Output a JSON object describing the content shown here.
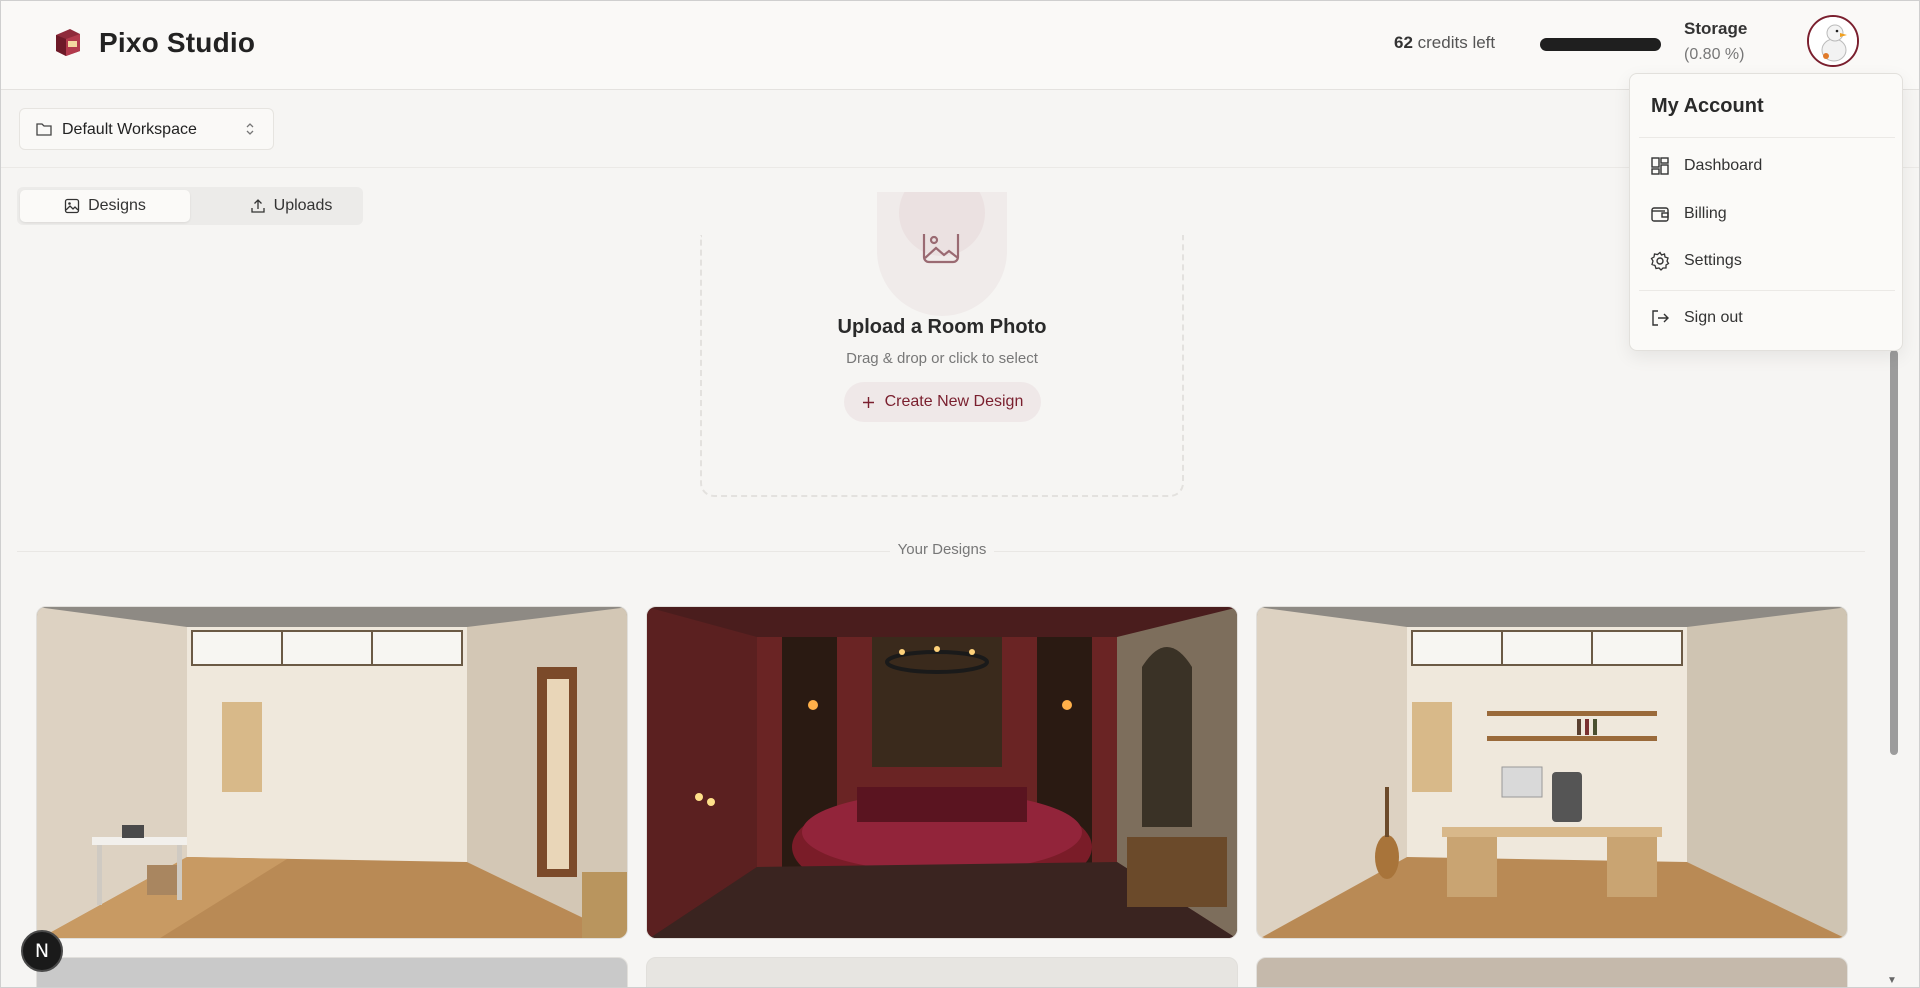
{
  "header": {
    "brand": "Pixo Studio",
    "credits_count": "62",
    "credits_suffix": " credits left",
    "storage_label": "Storage",
    "storage_percent": "(0.80 %)",
    "storage_fraction": 0.008
  },
  "workspace": {
    "selected": "Default Workspace"
  },
  "tabs": [
    {
      "label": "Designs",
      "icon": "image-icon",
      "active": true
    },
    {
      "label": "Uploads",
      "icon": "upload-icon",
      "active": false
    }
  ],
  "upload": {
    "title": "Upload a Room Photo",
    "subtitle": "Drag & drop or click to select",
    "button": "Create New Design",
    "icon": "image-plus-icon"
  },
  "designs": {
    "heading": "Your Designs"
  },
  "account_menu": {
    "title": "My Account",
    "items": [
      {
        "label": "Dashboard",
        "icon": "dashboard-icon"
      },
      {
        "label": "Billing",
        "icon": "wallet-icon"
      },
      {
        "label": "Settings",
        "icon": "gear-icon"
      },
      {
        "label": "Sign out",
        "icon": "logout-icon"
      }
    ]
  },
  "badge": {
    "text": "N"
  },
  "colors": {
    "accent": "#7a1f2e",
    "background": "#f6f5f3"
  }
}
